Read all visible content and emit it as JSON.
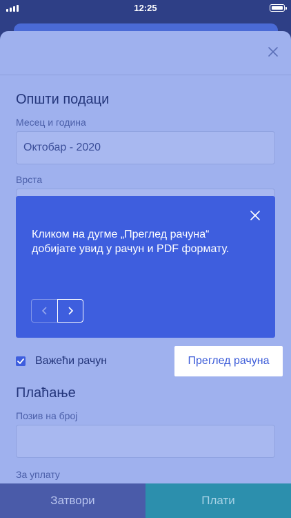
{
  "status_bar": {
    "time": "12:25"
  },
  "general": {
    "title": "Општи подаци",
    "month_label": "Месец и година",
    "month_value": "Октобар - 2020",
    "type_label": "Врста"
  },
  "tooltip": {
    "text": "Кликом на дугме „Преглед рачуна“ добијате увид у рачун и PDF формату."
  },
  "invoice": {
    "valid_label": "Важећи рачун",
    "preview_link": "Преглед рачуна"
  },
  "payment": {
    "title": "Плаћање",
    "reference_label": "Позив на број",
    "reference_value": "",
    "amount_label": "За уплату"
  },
  "actions": {
    "close_label": "Затвори",
    "pay_label": "Плати"
  },
  "colors": {
    "sheet": "#9fb1ee",
    "tooltip": "#3e5ede",
    "close_button": "#4a5ba9",
    "pay_button": "#2c8fad"
  }
}
